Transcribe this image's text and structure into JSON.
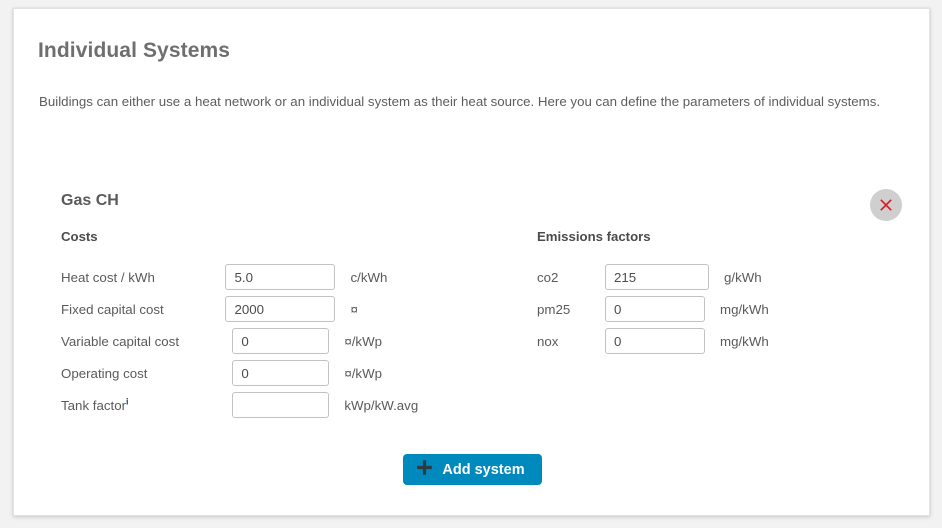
{
  "page": {
    "title": "Individual Systems",
    "description": "Buildings can either use a heat network or an individual system as their heat source. Here you can define the parameters of individual systems."
  },
  "theme": {
    "accent_blue": "#0089bd",
    "page_background": "#f2f2f2",
    "card_background": "#ffffff",
    "heading_color": "#6f6f6f",
    "label_color": "#5a5a5a",
    "remove_circle_color": "#cfcfcf",
    "remove_x_color": "#d62129",
    "info_marker_color": "#23427a"
  },
  "system": {
    "name": "Gas CH",
    "remove_icon": "close-x-icon",
    "costs": {
      "title": "Costs",
      "fields": [
        {
          "label": "Heat cost / kWh",
          "value": "5.0",
          "unit": "c/kWh",
          "info": false
        },
        {
          "label": "Fixed capital cost",
          "value": "2000",
          "unit": "¤",
          "info": false
        },
        {
          "label": "Variable capital cost",
          "value": "0",
          "unit": "¤/kWp",
          "info": false
        },
        {
          "label": "Operating cost",
          "value": "0",
          "unit": "¤/kWp",
          "info": false
        },
        {
          "label": "Tank factor",
          "value": "",
          "unit": "kWp/kW.avg",
          "info": true,
          "info_marker": "i"
        }
      ]
    },
    "emissions": {
      "title": "Emissions factors",
      "fields": [
        {
          "label": "co2",
          "value": "215",
          "unit": "g/kWh"
        },
        {
          "label": "pm25",
          "value": "0",
          "unit": "mg/kWh"
        },
        {
          "label": "nox",
          "value": "0",
          "unit": "mg/kWh"
        }
      ]
    }
  },
  "actions": {
    "add_system_label": "Add system",
    "add_system_icon": "plus-icon"
  }
}
